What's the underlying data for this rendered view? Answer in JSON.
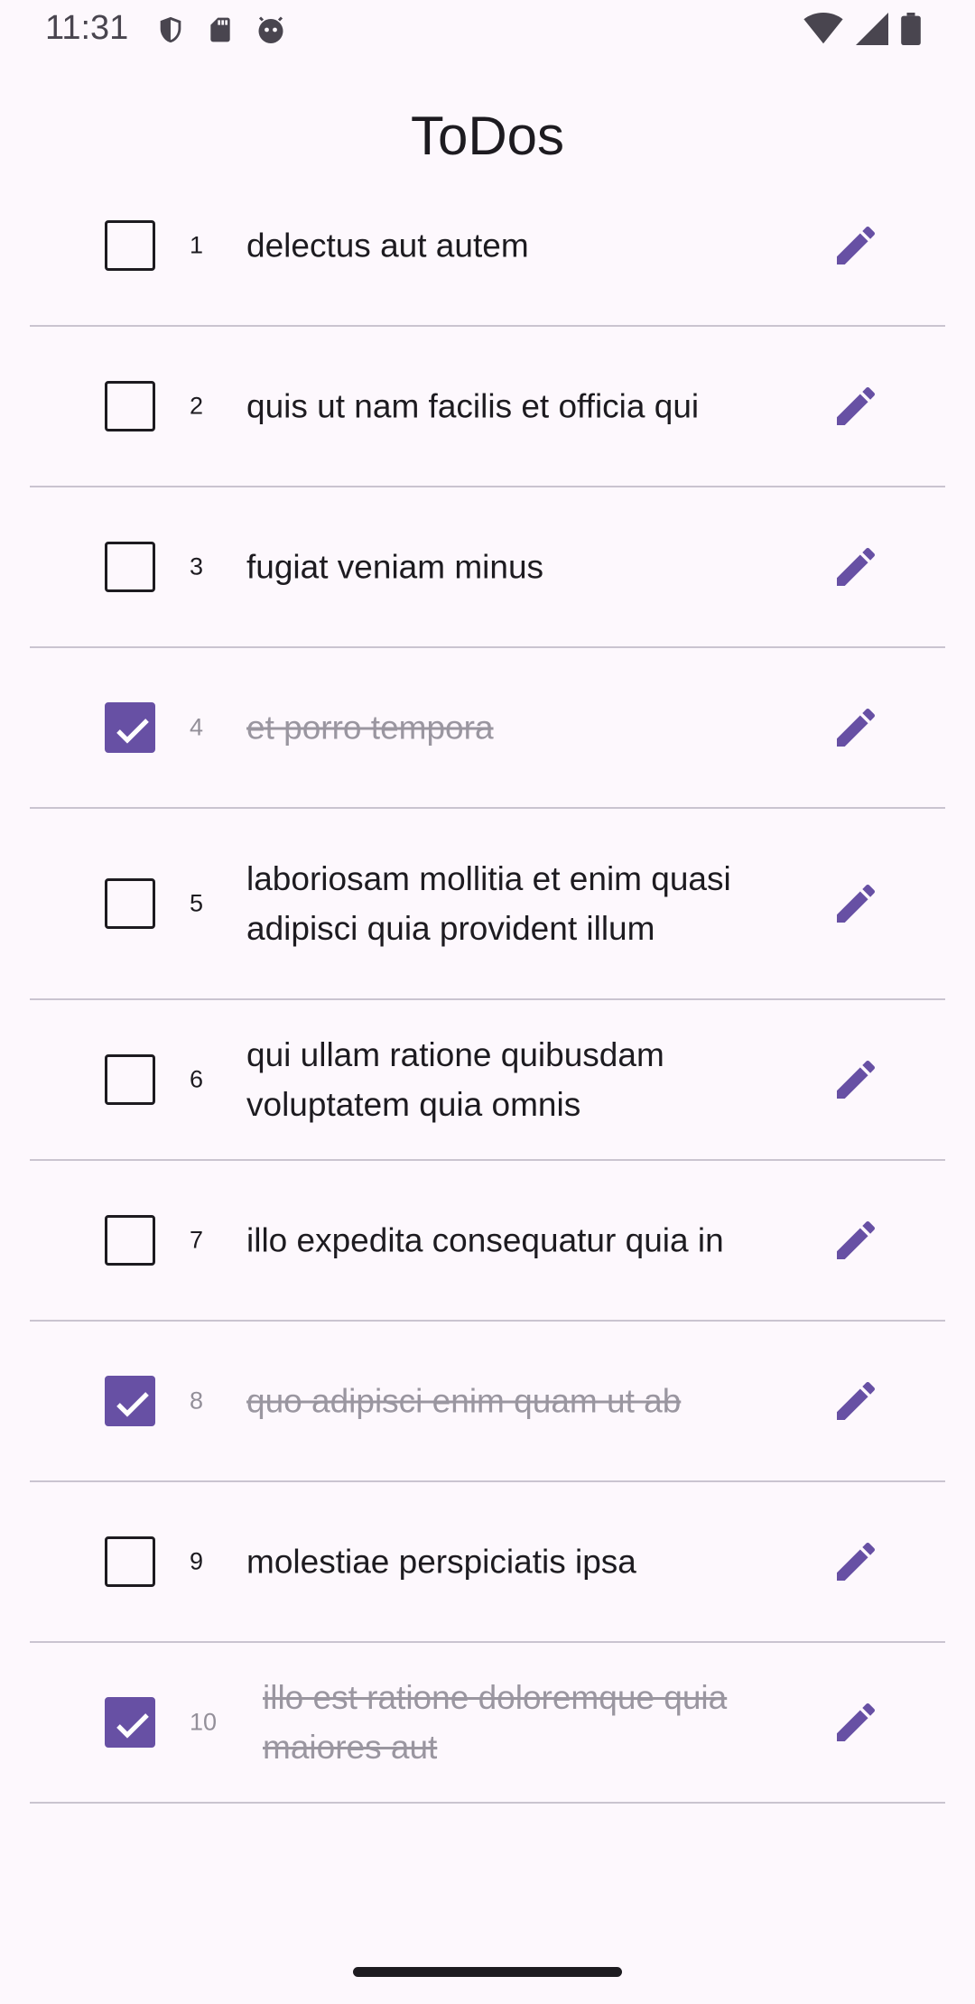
{
  "status_bar": {
    "time": "11:31"
  },
  "app": {
    "title": "ToDos"
  },
  "todos": [
    {
      "id": "1",
      "title": "delectus aut autem",
      "completed": false
    },
    {
      "id": "2",
      "title": "quis ut nam facilis et officia qui",
      "completed": false
    },
    {
      "id": "3",
      "title": "fugiat veniam minus",
      "completed": false
    },
    {
      "id": "4",
      "title": "et porro tempora",
      "completed": true
    },
    {
      "id": "5",
      "title": "laboriosam mollitia et enim quasi adipisci quia provident illum",
      "completed": false
    },
    {
      "id": "6",
      "title": "qui ullam ratione quibusdam voluptatem quia omnis",
      "completed": false
    },
    {
      "id": "7",
      "title": "illo expedita consequatur quia in",
      "completed": false
    },
    {
      "id": "8",
      "title": "quo adipisci enim quam ut ab",
      "completed": true
    },
    {
      "id": "9",
      "title": "molestiae perspiciatis ipsa",
      "completed": false
    },
    {
      "id": "10",
      "title": "illo est ratione doloremque quia maiores aut",
      "completed": true
    }
  ],
  "colors": {
    "accent": "#6750a4",
    "divider": "#cac4d0",
    "background": "#fdf8fd"
  },
  "icons": {
    "edit": "pencil-icon",
    "check": "checkmark-icon"
  }
}
